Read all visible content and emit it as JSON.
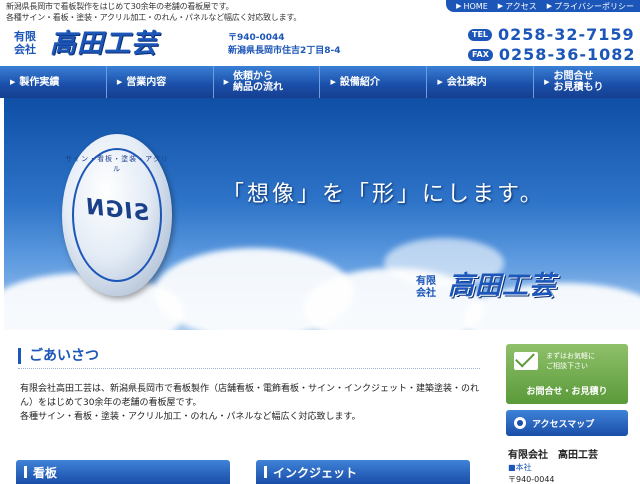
{
  "top": {
    "tagline_line1": "新潟県長岡市で看板製作をはじめて30余年の老舗の看板屋です。",
    "tagline_line2": "各種サイン・看板・塗装・アクリル加工・のれん・パネルなど幅広く対応致します。",
    "links": [
      {
        "label": "HOME"
      },
      {
        "label": "アクセス"
      },
      {
        "label": "プライバシーポリシー"
      }
    ]
  },
  "header": {
    "company_kind": "有限会社",
    "logo_text": "高田工芸",
    "postal": "〒940-0044",
    "address": "新潟県長岡市住吉2丁目8-4",
    "tel_label": "TEL",
    "tel": "0258-32-7159",
    "fax_label": "FAX",
    "fax": "0258-36-1082"
  },
  "nav": {
    "items": [
      {
        "label": "製作実績"
      },
      {
        "label": "営業内容"
      },
      {
        "label": "依頼から\n納品の流れ"
      },
      {
        "label": "設備紹介"
      },
      {
        "label": "会社案内"
      },
      {
        "label": "お問合せ\nお見積もり"
      }
    ]
  },
  "hero": {
    "badge_text": "SIGN",
    "badge_ring_text": "サイン・看板・塗装・アクリル",
    "slogan": "「想像」を「形」にします。",
    "company_kind": "有限会社",
    "logo_text": "高田工芸"
  },
  "greeting": {
    "title": "ごあいさつ",
    "paragraph1": "有限会社高田工芸は、新潟県長岡市で看板製作（店舗看板・電飾看板・サイン・インクジェット・建築塗装・のれん）をはじめて30余年の老舗の看板屋です。",
    "paragraph2": "各種サイン・看板・塗装・アクリル加工・のれん・パネルなど幅広く対応致します。"
  },
  "sections": {
    "signboard": "看板",
    "inkjet": "インクジェット"
  },
  "sidebar": {
    "contact_note_line1": "まずはお気軽に",
    "contact_note_line2": "ご相談下さい",
    "contact_cta": "お問合せ・お見積り",
    "access_label": "アクセスマップ",
    "company_name": "有限会社　高田工芸",
    "branch": "■本社",
    "postal": "〒940-0044"
  },
  "colors": {
    "brand_blue": "#1c56b8",
    "nav_blue": "#1a4ea8",
    "contact_green": "#5a9a3a"
  }
}
